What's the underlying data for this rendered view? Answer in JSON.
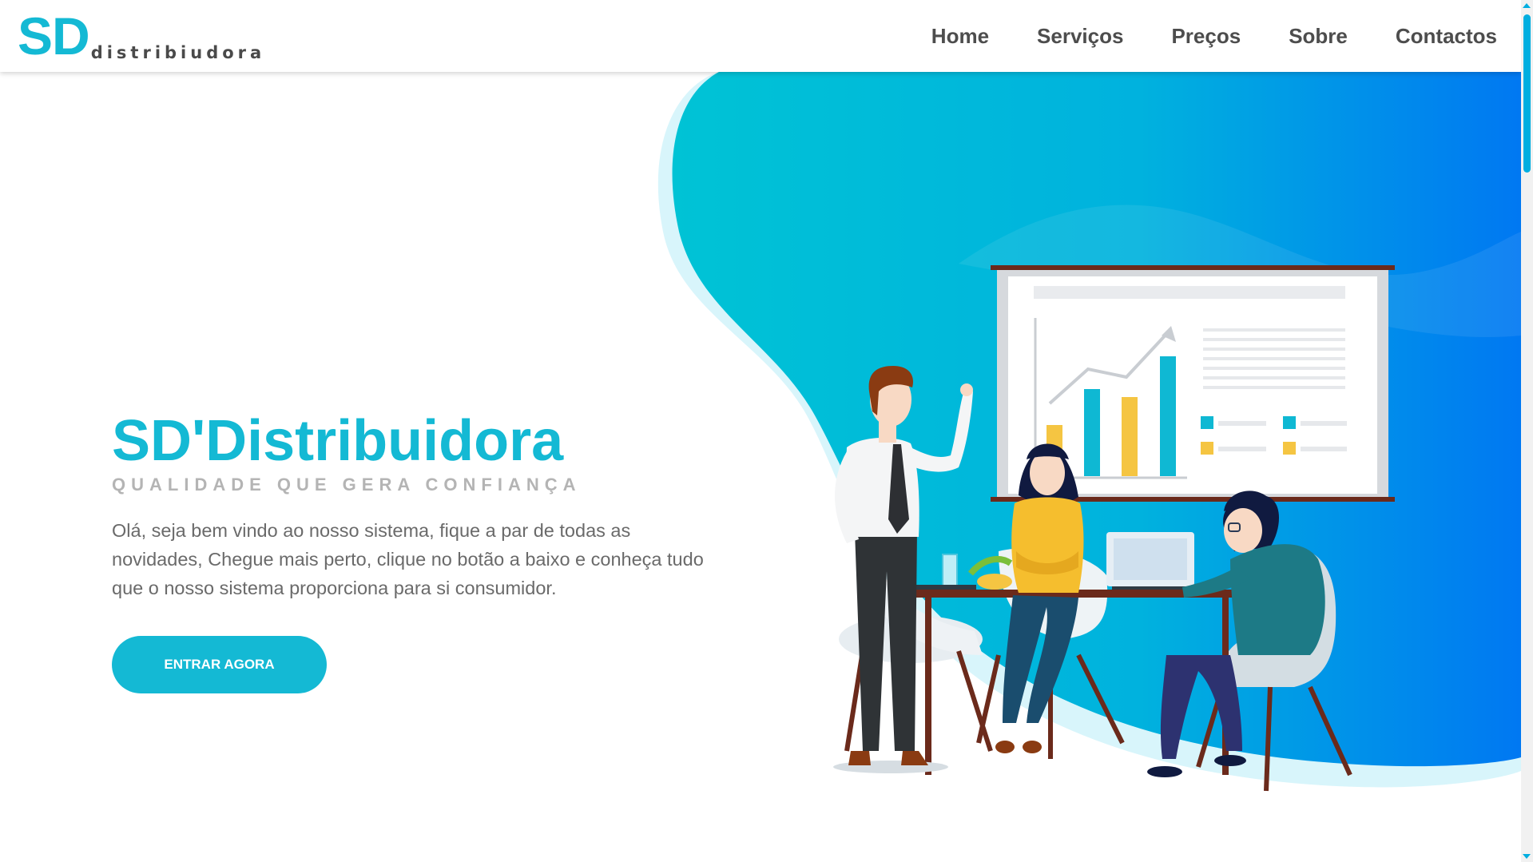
{
  "header": {
    "logo_big": "SD",
    "logo_small": "distribiudora",
    "nav": [
      {
        "label": "Home"
      },
      {
        "label": "Serviços"
      },
      {
        "label": "Preços"
      },
      {
        "label": "Sobre"
      },
      {
        "label": "Contactos"
      }
    ]
  },
  "hero": {
    "title": "SD'Distribuidora",
    "subtitle": "QUALIDADE QUE GERA CONFIANÇA",
    "description": "Olá, seja bem vindo ao nosso sistema, fique a par de todas as novidades, Chegue mais perto, clique no botão a baixo e conheça tudo que o nosso sistema proporciona para si consumidor.",
    "button_label": "ENTRAR AGORA"
  },
  "colors": {
    "accent": "#14b9d4",
    "gradient_start": "#00c2d6",
    "gradient_end": "#0078f0",
    "nav_text": "#4d4d4d"
  },
  "icons": {
    "illustration": "business-meeting-illustration"
  }
}
